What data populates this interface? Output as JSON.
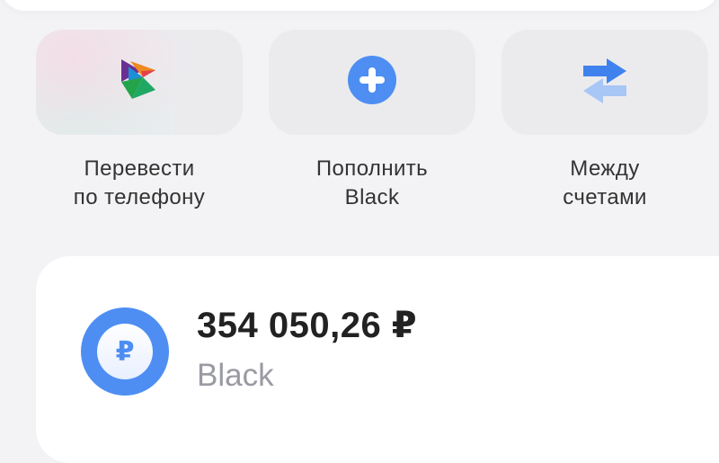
{
  "quick_actions": [
    {
      "id": "sbp",
      "icon": "sbp-logo-icon",
      "line1": "Перевести",
      "line2": "по телефону"
    },
    {
      "id": "topup",
      "icon": "plus-circle-icon",
      "line1": "Пополнить",
      "line2": "Black"
    },
    {
      "id": "between",
      "icon": "transfer-arrows-icon",
      "line1": "Между",
      "line2": "счетами"
    }
  ],
  "account": {
    "amount": "354 050,26 ₽",
    "name": "Black",
    "currency_symbol": "₽",
    "icon": "ruble-coin-icon"
  },
  "colors": {
    "accent": "#4e8ef3",
    "tile_background": "#ebebee",
    "page_background": "#f3f3f5",
    "amount_text": "#222222",
    "secondary_text": "#9a9aa3"
  }
}
